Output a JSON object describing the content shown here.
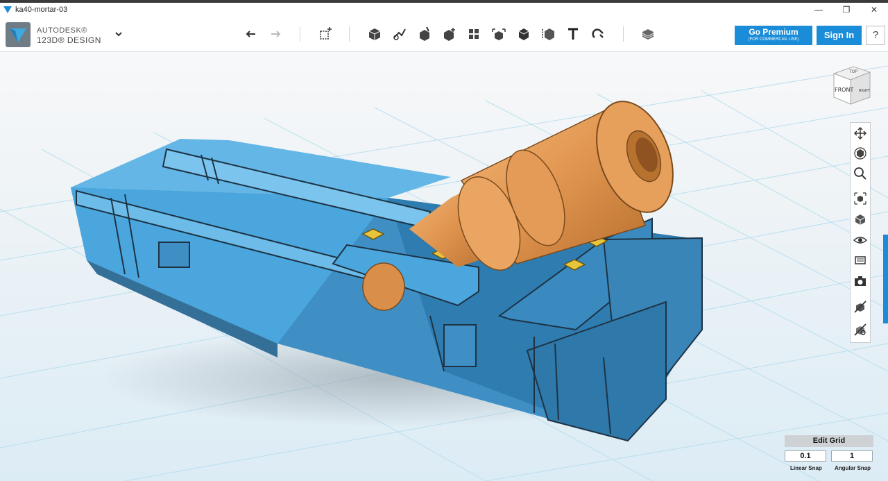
{
  "window": {
    "title": "ka40-mortar-03",
    "controls": [
      "—",
      "❐",
      "✕"
    ]
  },
  "brand": {
    "line1": "AUTODESK®",
    "line2": "123D® DESIGN"
  },
  "toolbar": {
    "premium_label": "Go Premium",
    "premium_sub": "(FOR COMMERCIAL USE)",
    "signin_label": "Sign In",
    "help_label": "?",
    "tools": [
      "undo-icon",
      "redo-icon",
      "transform-icon",
      "primitives-icon",
      "sketch-icon",
      "construct-icon",
      "modify-icon",
      "pattern-icon",
      "grouping-icon",
      "combine-icon",
      "measure-icon",
      "text-icon",
      "snap-icon",
      "material-icon"
    ]
  },
  "viewcube": {
    "top": "TOP",
    "front": "FRONT",
    "right": "RIGHT"
  },
  "nav": {
    "tools": [
      "pan-icon",
      "orbit-icon",
      "zoom-icon",
      "fit-icon",
      "view-icon",
      "visibility-icon",
      "material-view-icon",
      "camera-icon",
      "show-hide-icon",
      "settings-icon"
    ]
  },
  "grid": {
    "edit_label": "Edit Grid",
    "linear_value": "0.1",
    "angular_value": "1",
    "linear_label": "Linear Snap",
    "angular_label": "Angular Snap"
  },
  "colors": {
    "accent": "#1a8cd8",
    "model_blue": "#4aa6dc",
    "model_orange": "#e19a57",
    "grid_line": "#b9dff0"
  }
}
